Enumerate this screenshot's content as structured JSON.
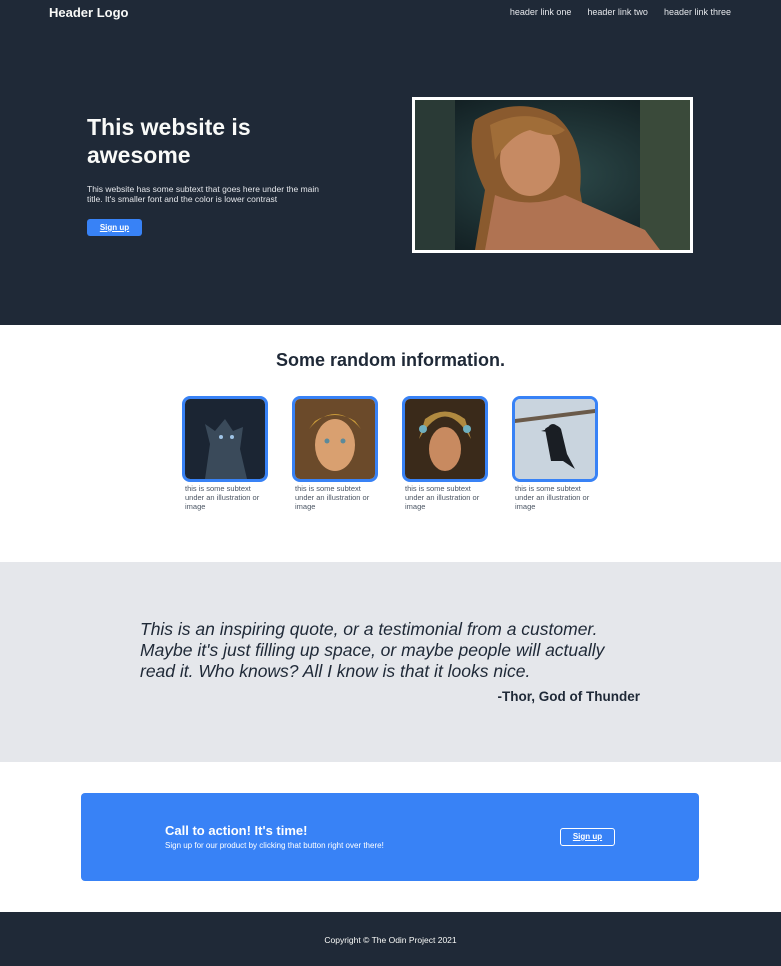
{
  "header": {
    "logo": "Header Logo",
    "links": [
      "header link one",
      "header link two",
      "header link three"
    ]
  },
  "hero": {
    "title": "This website is awesome",
    "subtitle": "This website has some subtext that goes here under the main title. It's smaller font and the color is lower contrast",
    "button": "Sign up",
    "image_icon": "warrior-portrait-image"
  },
  "info": {
    "title": "Some random information.",
    "cards": [
      {
        "icon": "wolf-image",
        "text": "this is some subtext under an illustration or image"
      },
      {
        "icon": "warrior-woman-image",
        "text": "this is some subtext under an illustration or image"
      },
      {
        "icon": "armored-warrior-image",
        "text": "this is some subtext under an illustration or image"
      },
      {
        "icon": "raven-image",
        "text": "this is some subtext under an illustration or image"
      }
    ]
  },
  "quote": {
    "text": "This is an inspiring quote, or a testimonial from a customer. Maybe it's just filling up space, or maybe people will actually read it. Who knows? All I know is that it looks nice.",
    "author": "-Thor, God of Thunder"
  },
  "cta": {
    "title": "Call to action! It's time!",
    "subtitle": "Sign up for our product by clicking that button right over there!",
    "button": "Sign up"
  },
  "footer": {
    "copyright": "Copyright © The Odin Project 2021"
  },
  "colors": {
    "dark": "#1f2937",
    "accent": "#3882f6",
    "light_gray": "#e5e7eb"
  }
}
